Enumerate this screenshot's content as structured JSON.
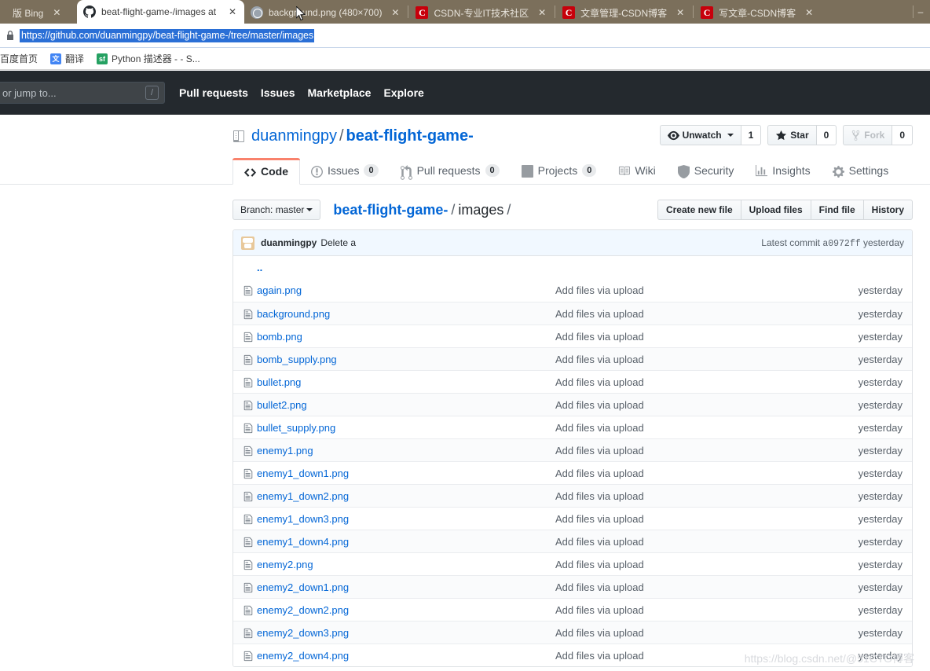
{
  "browser": {
    "tabs": [
      {
        "title": "版 Bing",
        "favicon": "bing-icon",
        "active": false,
        "partial": true
      },
      {
        "title": "beat-flight-game-/images at mas",
        "favicon": "github-icon",
        "active": true,
        "partial": false
      },
      {
        "title": "background.png (480×700)",
        "favicon": "image-icon",
        "active": false,
        "partial": false
      },
      {
        "title": "CSDN-专业IT技术社区",
        "favicon": "csdn-icon",
        "active": false,
        "partial": false
      },
      {
        "title": "文章管理-CSDN博客",
        "favicon": "csdn-icon",
        "active": false,
        "partial": false
      },
      {
        "title": "写文章-CSDN博客",
        "favicon": "csdn-icon",
        "active": false,
        "partial": false
      }
    ],
    "close_label": "✕",
    "minimize_label": "–",
    "url": "https://github.com/duanmingpy/beat-flight-game-/tree/master/images",
    "bookmarks": [
      {
        "label": "百度首页",
        "icon": "none"
      },
      {
        "label": "翻译",
        "icon": "translate-icon"
      },
      {
        "label": "Python 描述器 - - S...",
        "icon": "sf-icon",
        "icon_text": "sf"
      }
    ]
  },
  "github": {
    "header": {
      "search_placeholder": "or jump to...",
      "slash_hint": "/",
      "nav": [
        "Pull requests",
        "Issues",
        "Marketplace",
        "Explore"
      ]
    },
    "repo": {
      "owner": "duanmingpy",
      "name": "beat-flight-game-",
      "separator": "/",
      "actions": [
        {
          "label": "Unwatch",
          "count": "1",
          "icon": "eye-icon",
          "has_caret": true,
          "dim": false
        },
        {
          "label": "Star",
          "count": "0",
          "icon": "star-icon",
          "has_caret": false,
          "dim": false
        },
        {
          "label": "Fork",
          "count": "0",
          "icon": "fork-icon",
          "has_caret": false,
          "dim": true
        }
      ]
    },
    "tabs": [
      {
        "label": "Code",
        "icon": "code-icon",
        "count": null,
        "selected": true
      },
      {
        "label": "Issues",
        "icon": "issue-icon",
        "count": "0",
        "selected": false
      },
      {
        "label": "Pull requests",
        "icon": "pull-request-icon",
        "count": "0",
        "selected": false
      },
      {
        "label": "Projects",
        "icon": "project-icon",
        "count": "0",
        "selected": false
      },
      {
        "label": "Wiki",
        "icon": "book-icon",
        "count": null,
        "selected": false
      },
      {
        "label": "Security",
        "icon": "shield-icon",
        "count": null,
        "selected": false
      },
      {
        "label": "Insights",
        "icon": "graph-icon",
        "count": null,
        "selected": false
      },
      {
        "label": "Settings",
        "icon": "gear-icon",
        "count": null,
        "selected": false
      }
    ],
    "file_browser": {
      "branch_label": "Branch: master",
      "breadcrumb": {
        "repo": "beat-flight-game-",
        "dir": "images",
        "slash": "/"
      },
      "buttons": [
        "Create new file",
        "Upload files",
        "Find file",
        "History"
      ],
      "commit": {
        "author": "duanmingpy",
        "message": "Delete a",
        "latest_label": "Latest commit",
        "sha": "a0972ff",
        "age": "yesterday"
      },
      "parent_dir": "..",
      "files": [
        {
          "name": "again.png",
          "message": "Add files via upload",
          "age": "yesterday"
        },
        {
          "name": "background.png",
          "message": "Add files via upload",
          "age": "yesterday"
        },
        {
          "name": "bomb.png",
          "message": "Add files via upload",
          "age": "yesterday"
        },
        {
          "name": "bomb_supply.png",
          "message": "Add files via upload",
          "age": "yesterday"
        },
        {
          "name": "bullet.png",
          "message": "Add files via upload",
          "age": "yesterday"
        },
        {
          "name": "bullet2.png",
          "message": "Add files via upload",
          "age": "yesterday"
        },
        {
          "name": "bullet_supply.png",
          "message": "Add files via upload",
          "age": "yesterday"
        },
        {
          "name": "enemy1.png",
          "message": "Add files via upload",
          "age": "yesterday"
        },
        {
          "name": "enemy1_down1.png",
          "message": "Add files via upload",
          "age": "yesterday"
        },
        {
          "name": "enemy1_down2.png",
          "message": "Add files via upload",
          "age": "yesterday"
        },
        {
          "name": "enemy1_down3.png",
          "message": "Add files via upload",
          "age": "yesterday"
        },
        {
          "name": "enemy1_down4.png",
          "message": "Add files via upload",
          "age": "yesterday"
        },
        {
          "name": "enemy2.png",
          "message": "Add files via upload",
          "age": "yesterday"
        },
        {
          "name": "enemy2_down1.png",
          "message": "Add files via upload",
          "age": "yesterday"
        },
        {
          "name": "enemy2_down2.png",
          "message": "Add files via upload",
          "age": "yesterday"
        },
        {
          "name": "enemy2_down3.png",
          "message": "Add files via upload",
          "age": "yesterday"
        },
        {
          "name": "enemy2_down4.png",
          "message": "Add files via upload",
          "age": "yesterday"
        }
      ]
    }
  },
  "watermark": "https://blog.csdn.net/@51CTO博客",
  "colors": {
    "tabstrip": "#7b6f5b",
    "gh_header": "#24292e",
    "link": "#0366d6",
    "accent": "#f9826c",
    "commit_bar": "#f1f8ff"
  }
}
